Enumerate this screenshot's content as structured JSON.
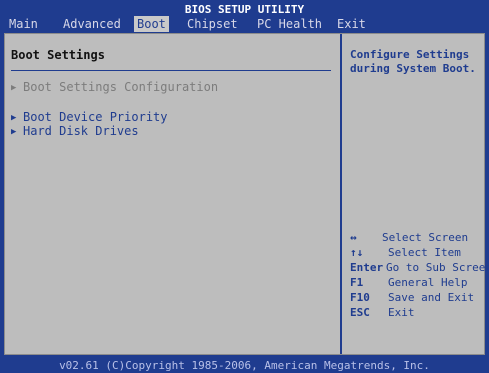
{
  "title": "BIOS SETUP UTILITY",
  "menu": [
    {
      "label": "Main",
      "active": false
    },
    {
      "label": "Advanced",
      "active": false
    },
    {
      "label": "Boot",
      "active": true
    },
    {
      "label": "Chipset",
      "active": false
    },
    {
      "label": "PC Health",
      "active": false
    },
    {
      "label": "Exit",
      "active": false
    }
  ],
  "main": {
    "section_title": "Boot Settings",
    "items": [
      {
        "label": "Boot Settings Configuration",
        "state": "dim"
      },
      {
        "label": "Boot Device Priority",
        "state": "normal"
      },
      {
        "label": "Hard Disk Drives",
        "state": "normal"
      }
    ]
  },
  "help": {
    "text": "Configure Settings during System Boot."
  },
  "keys": [
    {
      "key": "↔",
      "desc": "Select Screen"
    },
    {
      "key": "↑↓",
      "desc": "Select Item"
    },
    {
      "key": "Enter",
      "desc": "Go to Sub Screen"
    },
    {
      "key": "F1",
      "desc": "General Help"
    },
    {
      "key": "F10",
      "desc": "Save and Exit"
    },
    {
      "key": "ESC",
      "desc": "Exit"
    }
  ],
  "footer": "v02.61 (C)Copyright 1985-2006, American Megatrends, Inc.",
  "colors": {
    "background": "#1f3c8f",
    "panel": "#bdbdbd",
    "accent": "#1f3c8f"
  }
}
